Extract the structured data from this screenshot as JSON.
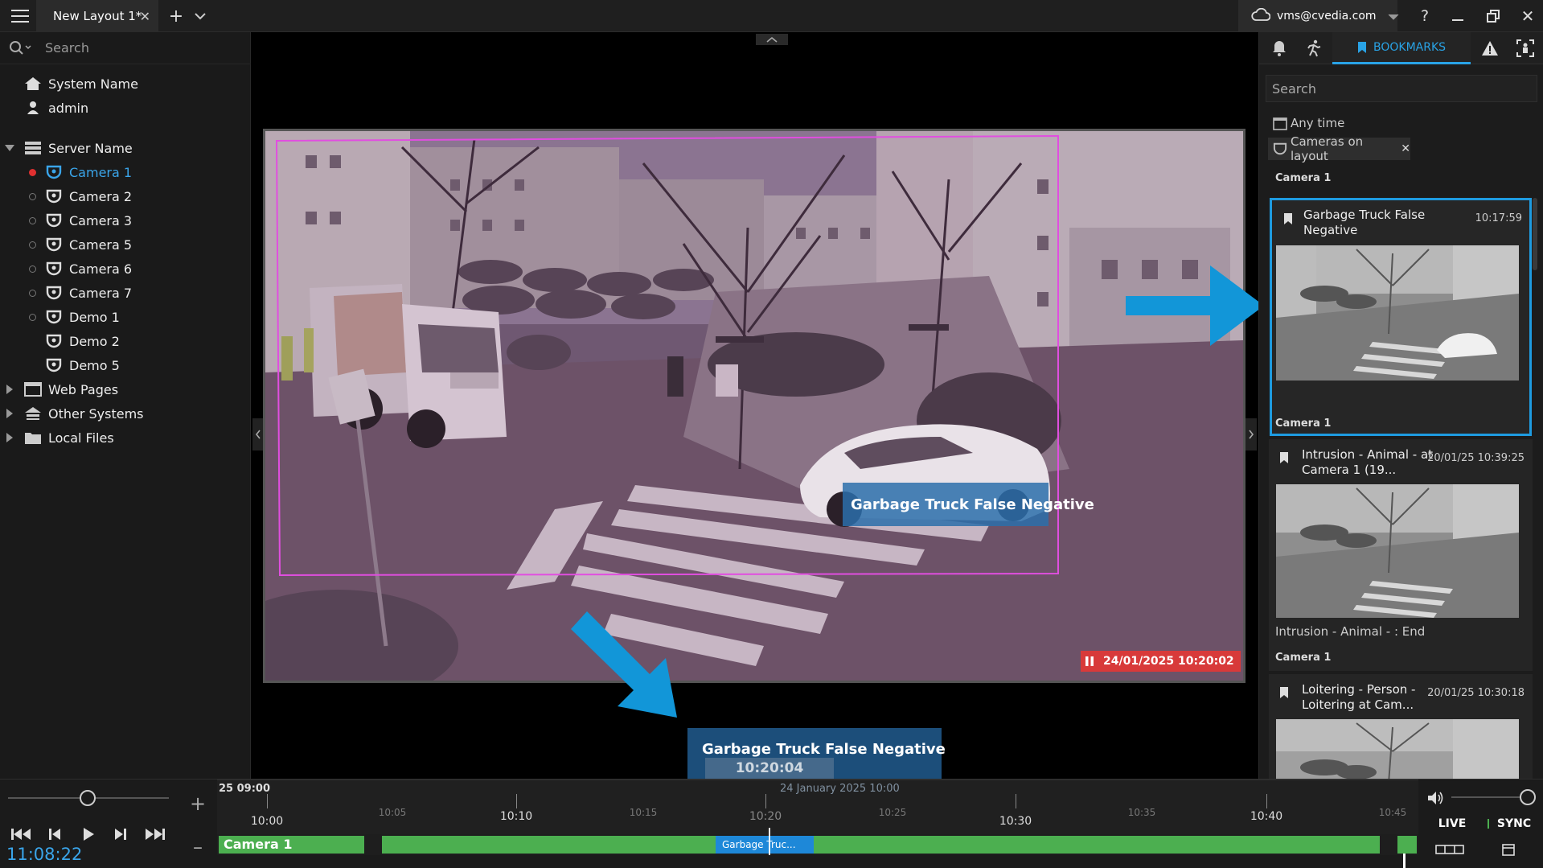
{
  "titlebar": {
    "tab_label": "New Layout 1*",
    "user": "vms@cvedia.com"
  },
  "left_panel": {
    "search_placeholder": "Search",
    "system_name": "System Name",
    "user_name": "admin",
    "server_name": "Server Name",
    "cameras": [
      "Camera 1",
      "Camera 2",
      "Camera 3",
      "Camera 5",
      "Camera 6",
      "Camera 7",
      "Demo 1",
      "Demo 2",
      "Demo 5"
    ],
    "web_pages": "Web Pages",
    "other_systems": "Other Systems",
    "local_files": "Local Files"
  },
  "video": {
    "overlay_label": "Garbage Truck False Negative",
    "timestamp": "24/01/2025 10:20:02"
  },
  "popup": {
    "title": "Garbage Truck False Negative",
    "time": "10:20:04",
    "date": "24 January 2025 10:00"
  },
  "right_panel": {
    "tab_bookmarks": "BOOKMARKS",
    "search_placeholder": "Search",
    "filter_time": "Any time",
    "filter_cameras": "Cameras on layout",
    "section_camera": "Camera 1",
    "bookmarks": [
      {
        "title": "Garbage Truck False Negative",
        "time": "10:17:59",
        "camera": "Camera 1",
        "description": ""
      },
      {
        "title": "Intrusion - Animal - at Camera 1 (19...",
        "time": "20/01/25 10:39:25",
        "camera": "Camera 1",
        "description": "Intrusion - Animal - : End"
      },
      {
        "title": "Loitering - Person - Loitering at Cam...",
        "time": "20/01/25 10:30:18",
        "camera": "",
        "description": ""
      }
    ]
  },
  "timeline": {
    "clock": "11:08:22",
    "date_left": "25 09:00",
    "major_ticks": [
      "10:00",
      "10:10",
      "10:20",
      "10:30",
      "10:40"
    ],
    "minor_ticks": [
      "10:05",
      "10:15",
      "10:25",
      "10:35",
      "10:45"
    ],
    "track_camera": "Camera 1",
    "bookmark_chip": "Garbage Truc...",
    "live_label": "LIVE",
    "sync_label": "SYNC"
  },
  "colors": {
    "accent": "#29a3e6",
    "highlight_border": "#1e9be0",
    "track_green": "#4caf50",
    "arrow_blue": "#1296d8",
    "timestamp_red": "#d83a3a"
  }
}
